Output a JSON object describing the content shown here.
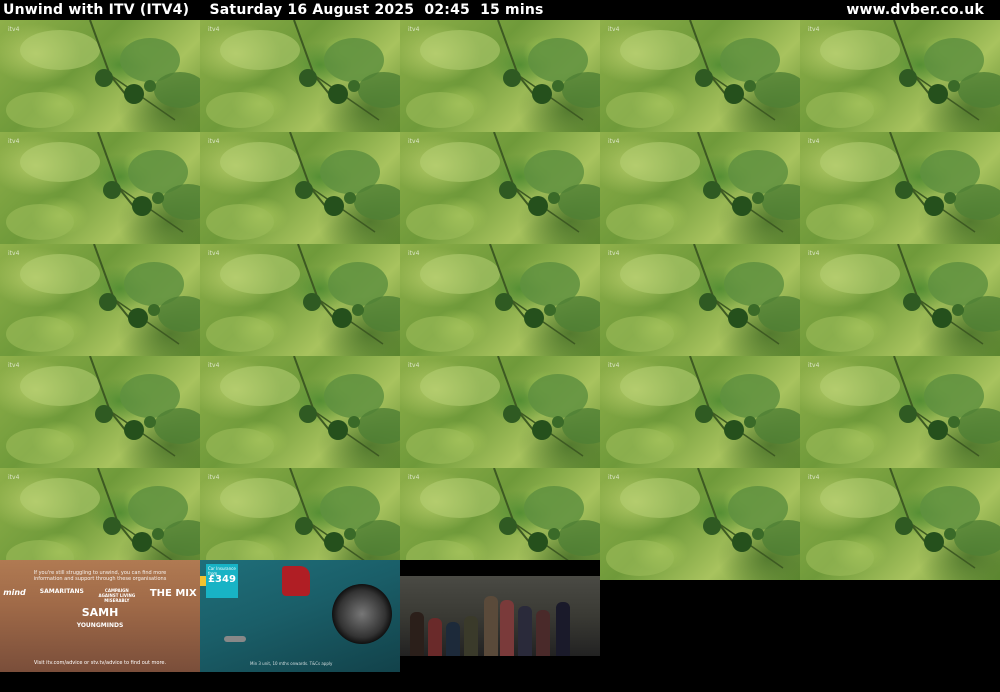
{
  "header": {
    "title": "Unwind with ITV (ITV4)",
    "datetime": "Saturday 16 August 2025  02:45  15 mins",
    "site": "www.dvber.co.uk"
  },
  "grid": {
    "columns": 5,
    "rows": 5,
    "thumb_watermark": "itv4"
  },
  "ads": {
    "ad1": {
      "text": "If you're still struggling to unwind, you can find more information and support through these organisations",
      "logos": [
        "mind",
        "SAMARITANS",
        "CAMPAIGN AGAINST LIVING MISERABLY",
        "THE MIX",
        "SAMH",
        "YOUNGMINDS"
      ],
      "footer": "Visit itv.com/advice or stv.tv/advice to find out more."
    },
    "ad2": {
      "panel_text": "Car Insurance from",
      "price": "£349",
      "small_print": "Min 3 unit, 10 mths onwards. T&Cs apply"
    }
  },
  "colors": {
    "background": "#000000",
    "header_text": "#ffffff",
    "foliage": "#7aa444"
  }
}
